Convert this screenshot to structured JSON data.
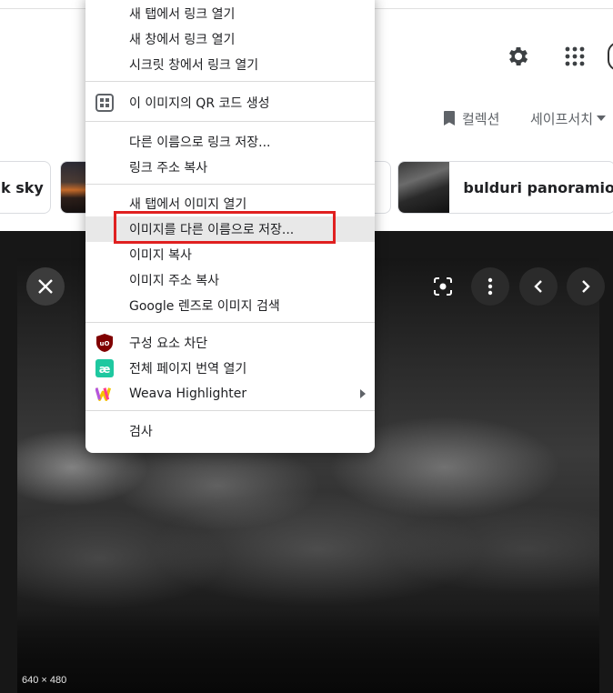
{
  "header": {
    "collection_label": "컬렉션",
    "safesearch_label": "세이프서치"
  },
  "related": {
    "left_chip": "k sky",
    "right_chip": "bulduri panoramio"
  },
  "viewer": {
    "dimensions": "640 × 480"
  },
  "context_menu": {
    "items": [
      {
        "label": "새 탭에서 링크 열기"
      },
      {
        "label": "새 창에서 링크 열기"
      },
      {
        "label": "시크릿 창에서 링크 열기"
      },
      {
        "label": "이 이미지의 QR 코드 생성"
      },
      {
        "label": "다른 이름으로 링크 저장..."
      },
      {
        "label": "링크 주소 복사"
      },
      {
        "label": "새 탭에서 이미지 열기"
      },
      {
        "label": "이미지를 다른 이름으로 저장..."
      },
      {
        "label": "이미지 복사"
      },
      {
        "label": "이미지 주소 복사"
      },
      {
        "label": "Google 렌즈로 이미지 검색"
      },
      {
        "label": "구성 요소 차단"
      },
      {
        "label": "전체 페이지 번역 열기"
      },
      {
        "label": "Weava Highlighter"
      },
      {
        "label": "검사"
      }
    ],
    "highlighted_index": 7,
    "extension_colors": {
      "ublock": "#800000",
      "translate": "#1ec8a0",
      "weava": "#f5c400"
    }
  }
}
